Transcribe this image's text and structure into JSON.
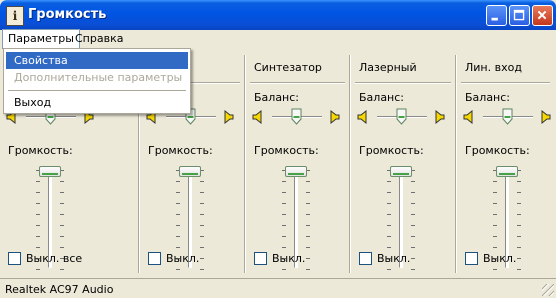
{
  "window": {
    "title": "Громкость",
    "icon": "info-icon"
  },
  "titlebar_buttons": {
    "minimize": "minimize-icon",
    "maximize": "maximize-icon",
    "close": "close-icon"
  },
  "menubar": {
    "params": "Параметры",
    "help": "Справка"
  },
  "dropdown": {
    "properties": "Свойства",
    "advanced": "Дополнительные параметры",
    "exit": "Выход"
  },
  "columns": [
    {
      "title": "",
      "balance_label": "",
      "volume_label": "Громкость:",
      "mute_label": "Выкл. все",
      "muted": false
    },
    {
      "title": "",
      "balance_label": "",
      "volume_label": "Громкость:",
      "mute_label": "Выкл.",
      "muted": false
    },
    {
      "title": "Синтезатор",
      "balance_label": "Баланс:",
      "volume_label": "Громкость:",
      "mute_label": "Выкл.",
      "muted": false
    },
    {
      "title": "Лазерный",
      "balance_label": "Баланс:",
      "volume_label": "Громкость:",
      "mute_label": "Выкл.",
      "muted": false
    },
    {
      "title": "Лин. вход",
      "balance_label": "Баланс:",
      "volume_label": "Громкость:",
      "mute_label": "Выкл.",
      "muted": false
    }
  ],
  "status": {
    "device": "Realtek AC97 Audio"
  },
  "colors": {
    "titlebar": "#0054E3",
    "menu_highlight": "#316AC5",
    "face": "#ECE9D8",
    "thumb_accent": "#45A245"
  }
}
